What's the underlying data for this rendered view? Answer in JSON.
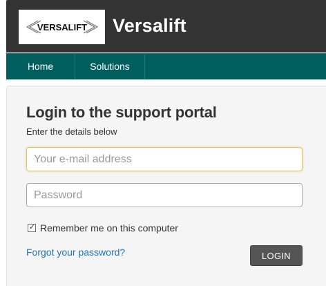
{
  "header": {
    "logo_text": "VERSALIFT",
    "brand": "Versalift"
  },
  "nav": {
    "items": [
      {
        "label": "Home"
      },
      {
        "label": "Solutions"
      }
    ]
  },
  "login": {
    "title": "Login to the support portal",
    "subtitle": "Enter the details below",
    "email_placeholder": "Your e-mail address",
    "email_value": "",
    "password_placeholder": "Password",
    "password_value": "",
    "remember_label": "Remember me on this computer",
    "remember_checked": true,
    "forgot_label": "Forgot your password?",
    "login_label": "LOGIN"
  },
  "colors": {
    "header_bg": "#333333",
    "nav_bg": "#005f5e",
    "link": "#1d75b9",
    "button_bg": "#555555",
    "focus_border": "#e8c267"
  }
}
